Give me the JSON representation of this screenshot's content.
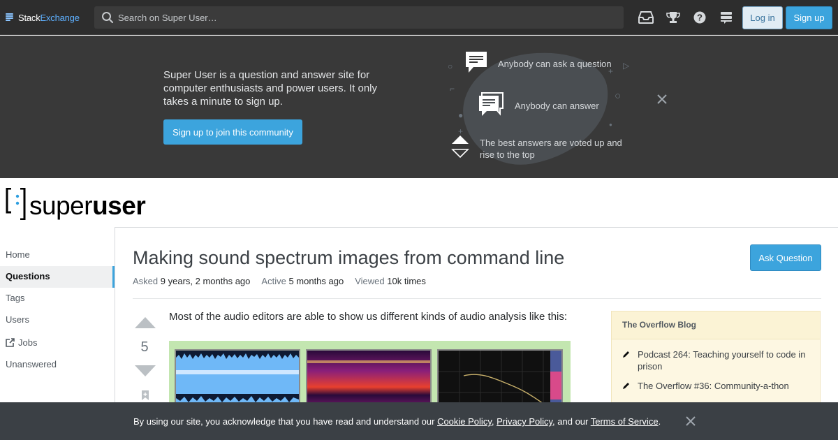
{
  "topbar": {
    "brand_stack": "Stack",
    "brand_exchange": "Exchange",
    "search_placeholder": "Search on Super User…",
    "login_label": "Log in",
    "signup_label": "Sign up",
    "icons": [
      "inbox-icon",
      "achievements-icon",
      "help-icon",
      "site-switcher-icon"
    ]
  },
  "hero": {
    "text": "Super User is a question and answer site for computer enthusiasts and power users. It only takes a minute to sign up.",
    "button": "Sign up to join this community",
    "items": [
      "Anybody can ask a question",
      "Anybody can answer",
      "The best answers are voted up and rise to the top"
    ]
  },
  "brand": {
    "light": "super",
    "bold": "user"
  },
  "nav": {
    "items": [
      {
        "label": "Home",
        "active": false
      },
      {
        "label": "Questions",
        "active": true
      },
      {
        "label": "Tags",
        "active": false
      },
      {
        "label": "Users",
        "active": false
      },
      {
        "label": "Jobs",
        "active": false
      },
      {
        "label": "Unanswered",
        "active": false
      }
    ]
  },
  "question": {
    "title": "Making sound spectrum images from command line",
    "ask_button": "Ask Question",
    "asked_label": "Asked",
    "asked_value": "9 years, 2 months ago",
    "active_label": "Active",
    "active_value": "5 months ago",
    "viewed_label": "Viewed",
    "viewed_value": "10k times",
    "votes": "5",
    "body": "Most of the audio editors are able to show us different kinds of audio analysis like this:"
  },
  "blog": {
    "title": "The Overflow Blog",
    "items": [
      "Podcast 264: Teaching yourself to code in prison",
      "The Overflow #36: Community-a-thon"
    ]
  },
  "cookie": {
    "prefix": "By using our site, you acknowledge that you have read and understand our ",
    "cookie_policy": "Cookie Policy",
    "sep1": ", ",
    "privacy_policy": "Privacy Policy",
    "sep2": ", and our ",
    "terms": "Terms of Service",
    "suffix": "."
  },
  "colors": {
    "accent": "#3ca4dd",
    "topbar": "#2d2d2d",
    "hero": "#393939"
  }
}
